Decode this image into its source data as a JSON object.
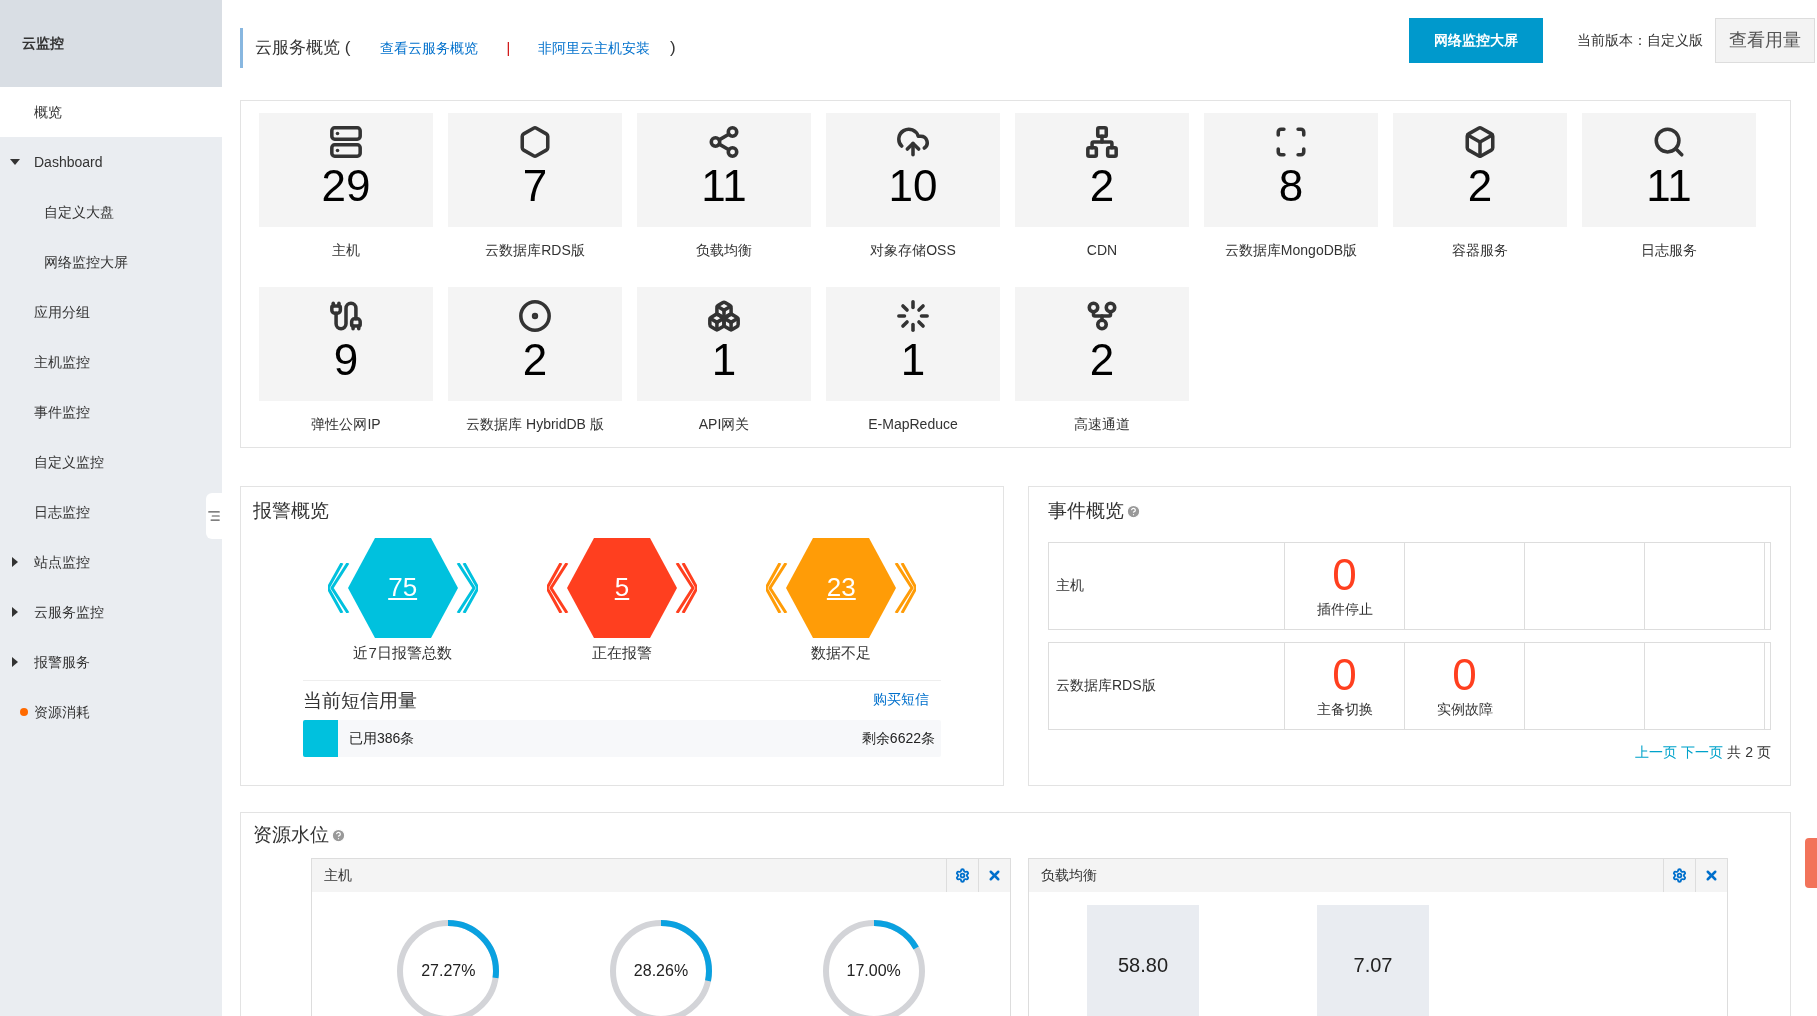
{
  "sidebar": {
    "title": "云监控",
    "items": [
      {
        "kind": "item",
        "label": "概览",
        "selected": true
      },
      {
        "kind": "group",
        "label": "Dashboard",
        "expanded": true,
        "selected": false,
        "children": [
          {
            "kind": "subitem",
            "label": "自定义大盘",
            "selected": false
          },
          {
            "kind": "subitem",
            "label": "网络监控大屏",
            "selected": false
          }
        ]
      },
      {
        "kind": "item",
        "label": "应用分组",
        "selected": false
      },
      {
        "kind": "item",
        "label": "主机监控",
        "selected": false
      },
      {
        "kind": "item",
        "label": "事件监控",
        "selected": false
      },
      {
        "kind": "item",
        "label": "自定义监控",
        "selected": false
      },
      {
        "kind": "item",
        "label": "日志监控",
        "selected": false
      },
      {
        "kind": "group",
        "label": "站点监控",
        "expanded": false,
        "selected": false
      },
      {
        "kind": "group",
        "label": "云服务监控",
        "expanded": false,
        "selected": false
      },
      {
        "kind": "group",
        "label": "报警服务",
        "expanded": false,
        "selected": false
      },
      {
        "kind": "dot",
        "label": "资源消耗",
        "color": "#ff6a00",
        "selected": false
      }
    ]
  },
  "header": {
    "title": "云服务概览 (",
    "links": [
      "查看云服务概览",
      "非阿里云主机安装"
    ],
    "separator": "|",
    "close": ")",
    "primary_button": "网络监控大屏",
    "version": "当前版本：自定义版",
    "usage_button": "查看用量"
  },
  "services": [
    {
      "count": "29",
      "label": "主机"
    },
    {
      "count": "7",
      "label": "云数据库RDS版"
    },
    {
      "count": "11",
      "label": "负载均衡"
    },
    {
      "count": "10",
      "label": "对象存储OSS"
    },
    {
      "count": "2",
      "label": "CDN"
    },
    {
      "count": "8",
      "label": "云数据库MongoDB版"
    },
    {
      "count": "2",
      "label": "容器服务"
    },
    {
      "count": "11",
      "label": "日志服务"
    },
    {
      "count": "9",
      "label": "弹性公网IP"
    },
    {
      "count": "2",
      "label": "云数据库 HybridDB 版"
    },
    {
      "count": "1",
      "label": "API网关"
    },
    {
      "count": "1",
      "label": "E-MapReduce"
    },
    {
      "count": "2",
      "label": "高速通道"
    }
  ],
  "alarms": {
    "title": "报警概览",
    "stats": [
      {
        "value": "75",
        "label": "近7日报警总数",
        "color": "#00c1de"
      },
      {
        "value": "5",
        "label": "正在报警",
        "color": "#ff3f1f"
      },
      {
        "value": "23",
        "label": "数据不足",
        "color": "#ff9c07"
      }
    ],
    "sms": {
      "title": "当前短信用量",
      "link": "购买短信",
      "used": "已用386条",
      "remaining": "剩余6622条",
      "level": 0.055
    }
  },
  "events": {
    "title": "事件概览",
    "rows": [
      {
        "name": "主机",
        "events": [
          {
            "value": "0",
            "label": "插件停止"
          }
        ]
      },
      {
        "name": "云数据库RDS版",
        "events": [
          {
            "value": "0",
            "label": "主备切换"
          },
          {
            "value": "0",
            "label": "实例故障"
          }
        ]
      }
    ],
    "pager": {
      "prev": "上一页",
      "next": "下一页",
      "total": "共 2 页"
    }
  },
  "resources": {
    "title": "资源水位",
    "panels": [
      {
        "kind": "donuts",
        "title": "主机",
        "items": [
          {
            "reading": "27.27%",
            "level": 0.2727
          },
          {
            "reading": "28.26%",
            "level": 0.2826
          },
          {
            "reading": "17.00%",
            "level": 0.17
          }
        ]
      },
      {
        "kind": "tiles",
        "title": "负载均衡",
        "items": [
          {
            "reading": "58.80"
          },
          {
            "reading": "7.07"
          }
        ]
      }
    ]
  }
}
